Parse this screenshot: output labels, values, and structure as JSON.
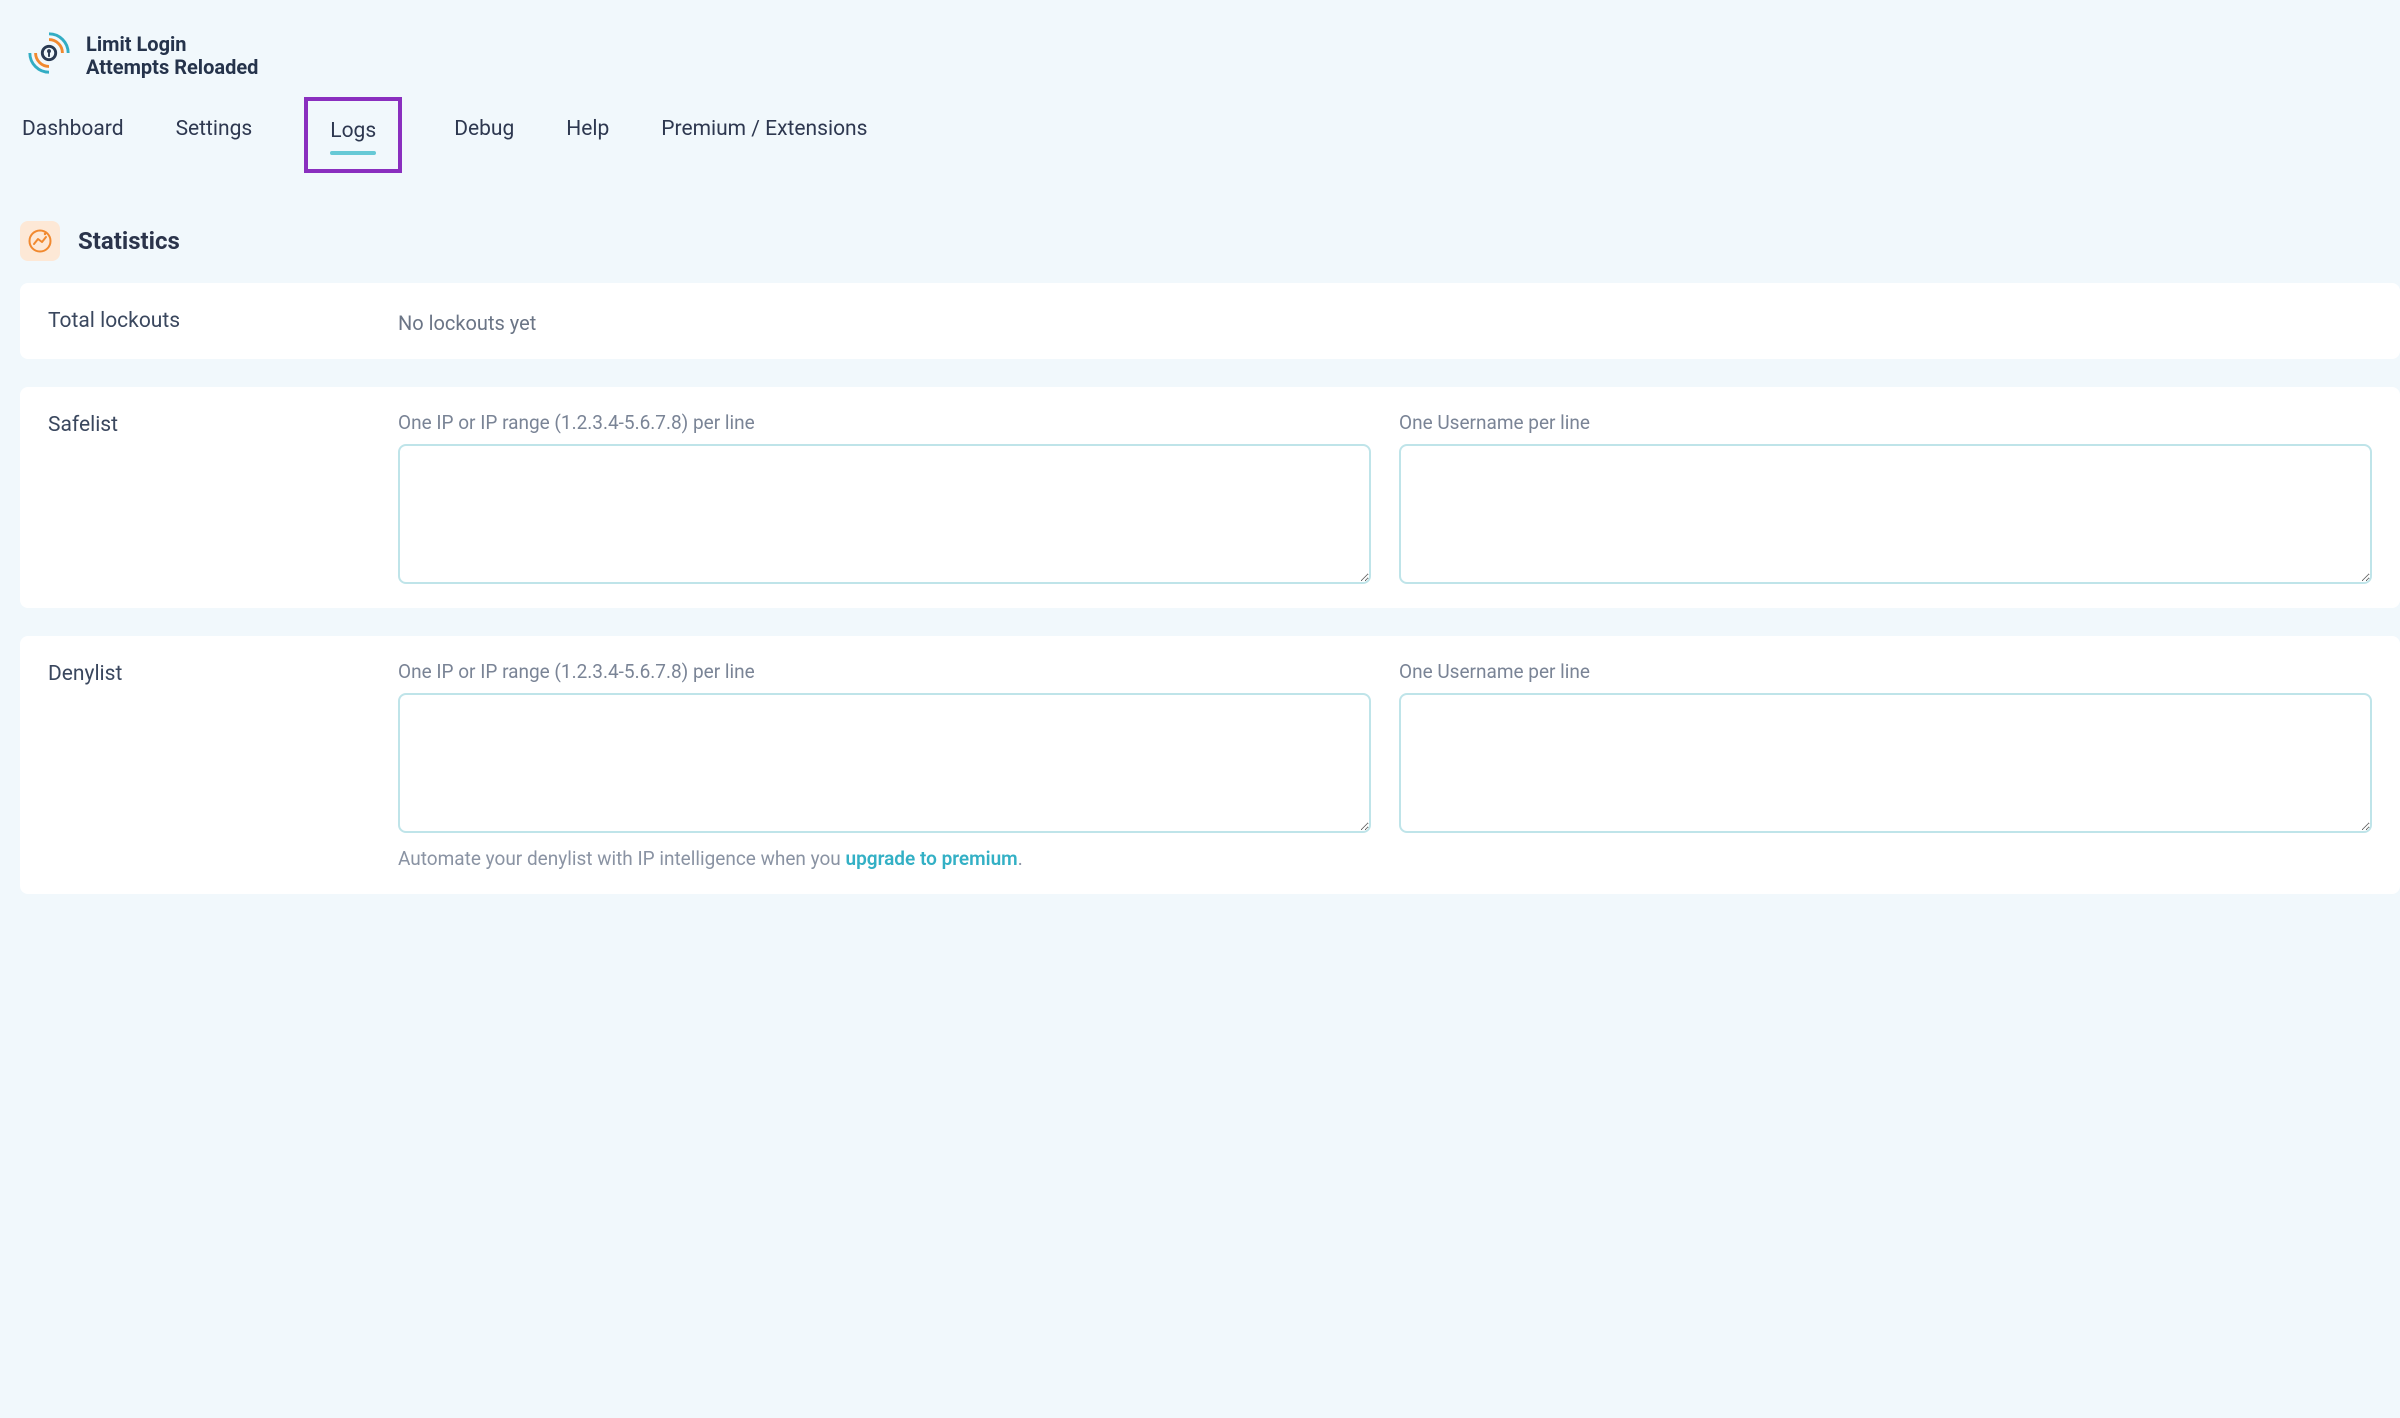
{
  "brand": {
    "line1": "Limit Login",
    "line2": "Attempts Reloaded"
  },
  "tabs": {
    "dashboard": "Dashboard",
    "settings": "Settings",
    "logs": "Logs",
    "debug": "Debug",
    "help": "Help",
    "premium": "Premium / Extensions",
    "active": "logs"
  },
  "sections": {
    "statistics_title": "Statistics"
  },
  "lockouts": {
    "label": "Total lockouts",
    "value": "No lockouts yet"
  },
  "safelist": {
    "label": "Safelist",
    "ip_hint": "One IP or IP range (1.2.3.4-5.6.7.8) per line",
    "user_hint": "One Username per line",
    "ip_value": "",
    "user_value": ""
  },
  "denylist": {
    "label": "Denylist",
    "ip_hint": "One IP or IP range (1.2.3.4-5.6.7.8) per line",
    "user_hint": "One Username per line",
    "ip_value": "",
    "user_value": "",
    "footnote_prefix": "Automate your denylist with IP intelligence when you ",
    "footnote_link": "upgrade to premium",
    "footnote_suffix": "."
  }
}
